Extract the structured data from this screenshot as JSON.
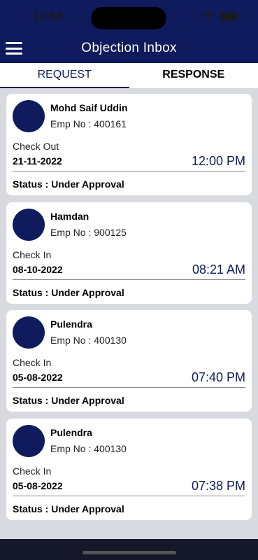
{
  "status_bar": {
    "time": "12:54",
    "icons": [
      "wifi-icon",
      "battery-icon"
    ]
  },
  "header": {
    "title": "Objection Inbox",
    "menu_icon": "hamburger-menu-icon",
    "color": "#0f1b5c"
  },
  "tabs": [
    {
      "label": "REQUEST",
      "active": true
    },
    {
      "label": "RESPONSE",
      "active": false
    }
  ],
  "requests": [
    {
      "name": "Mohd Saif Uddin",
      "emp_no": "Emp No : 400161",
      "check_type": "Check Out",
      "date": "21-11-2022",
      "time": "12:00 PM",
      "status": "Status : Under Approval"
    },
    {
      "name": "Hamdan",
      "emp_no": "Emp No : 900125",
      "check_type": "Check In",
      "date": "08-10-2022",
      "time": "08:21 AM",
      "status": "Status : Under Approval"
    },
    {
      "name": "Pulendra",
      "emp_no": "Emp No : 400130",
      "check_type": "Check In",
      "date": "05-08-2022",
      "time": "07:40 PM",
      "status": "Status : Under Approval"
    },
    {
      "name": "Pulendra",
      "emp_no": "Emp No : 400130",
      "check_type": "Check In",
      "date": "05-08-2022",
      "time": "07:38 PM",
      "status": "Status : Under Approval"
    }
  ]
}
